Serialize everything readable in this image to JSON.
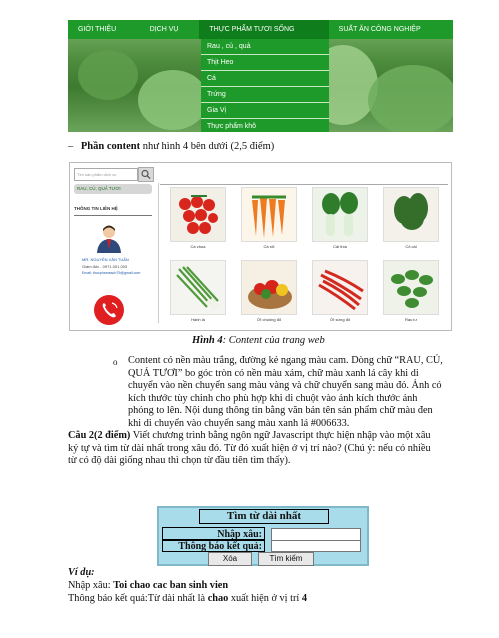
{
  "menu": {
    "items": [
      "GIỚI THIỆU",
      "DỊCH VỤ",
      "THỰC PHẨM TƯƠI SỐNG",
      "SUẤT ĂN CÔNG NGHIỆP"
    ],
    "dropdown": [
      "Rau , củ , quả",
      "Thịt Heo",
      "Cá",
      "Trứng",
      "Gia Vị",
      "Thực phẩm khô"
    ]
  },
  "section_content": {
    "dash": "–",
    "bold": "Phần content",
    "rest": " như hình 4 bên dưới (2,5 điểm)"
  },
  "content_page": {
    "search_placeholder": "Tìm sản phẩm dịch vụ",
    "category": "RAU, CỦ, QUẢ TƯƠI",
    "contact_title": "THÔNG TIN LIÊN HỆ",
    "contact_name": "MR. NGUYỄN VĂN TUẤN",
    "contact_role": "Giám đốc - 0971 001 003",
    "contact_email": "Email: thucphamsach79@gmail.com",
    "products": [
      "Cà chua",
      "Cà rốt",
      "Cải thìa",
      "Cỏ cải",
      "Hành lá",
      "Ớt chuông đỏ",
      "Ớt sừng đỏ",
      "Rau lư"
    ]
  },
  "caption4": {
    "bold": "Hình 4",
    "rest": ": Content của trang web"
  },
  "bullet": {
    "mark": "o",
    "lines": [
      "Content có nền màu trắng, đường kẻ ngang màu cam. Dòng chữ “RAU, CỦ,",
      "QUẢ TƯƠI” bo góc tròn có nền màu xám, chữ màu xanh lá cây khi di",
      "chuyển vào nền chuyển sang màu vàng và chữ chuyển sang màu đỏ. Ảnh có",
      "kích thước tùy chỉnh cho phù hợp khi di chuột vào ảnh kích thước ảnh",
      "phóng to lên. Nội dung thông tin bằng văn bản tên sản phẩm chữ màu đen",
      "khi di chuyển vào chuyển sang màu xanh lá #006633."
    ]
  },
  "question2": {
    "bold": "Câu 2(2 điểm)",
    "lines": [
      " Viết chương trình bằng ngôn ngữ Javascript thực hiện nhập vào một xâu",
      "ký tự và tìm từ dài nhất trong xâu đó. Từ đó xuất hiện ở vị trí nào? (Chú ý: nếu có nhiều",
      "từ có độ dài giống nhau thì chọn từ đầu tiên tìm thấy)."
    ]
  },
  "form": {
    "title": "Tìm từ dài nhất",
    "label_input": "Nhập xâu:",
    "label_result": "Thông báo kết quả:",
    "btn_clear": "Xóa",
    "btn_search": "Tìm kiếm"
  },
  "example": {
    "heading": "Ví dụ:",
    "input_prefix": "Nhập xâu: ",
    "input_value": "Toi chao cac ban sinh vien",
    "result_prefix": "Thông báo kết quả:Từ dài nhất là ",
    "result_word": "chao",
    "result_mid": " xuất hiện ở vị trí ",
    "result_pos": "4"
  },
  "colors": {
    "menu_green": "#1e9a2a",
    "form_bg": "#a8dcea",
    "link_blue": "#1e5aa8",
    "phone_red": "#e02020"
  }
}
